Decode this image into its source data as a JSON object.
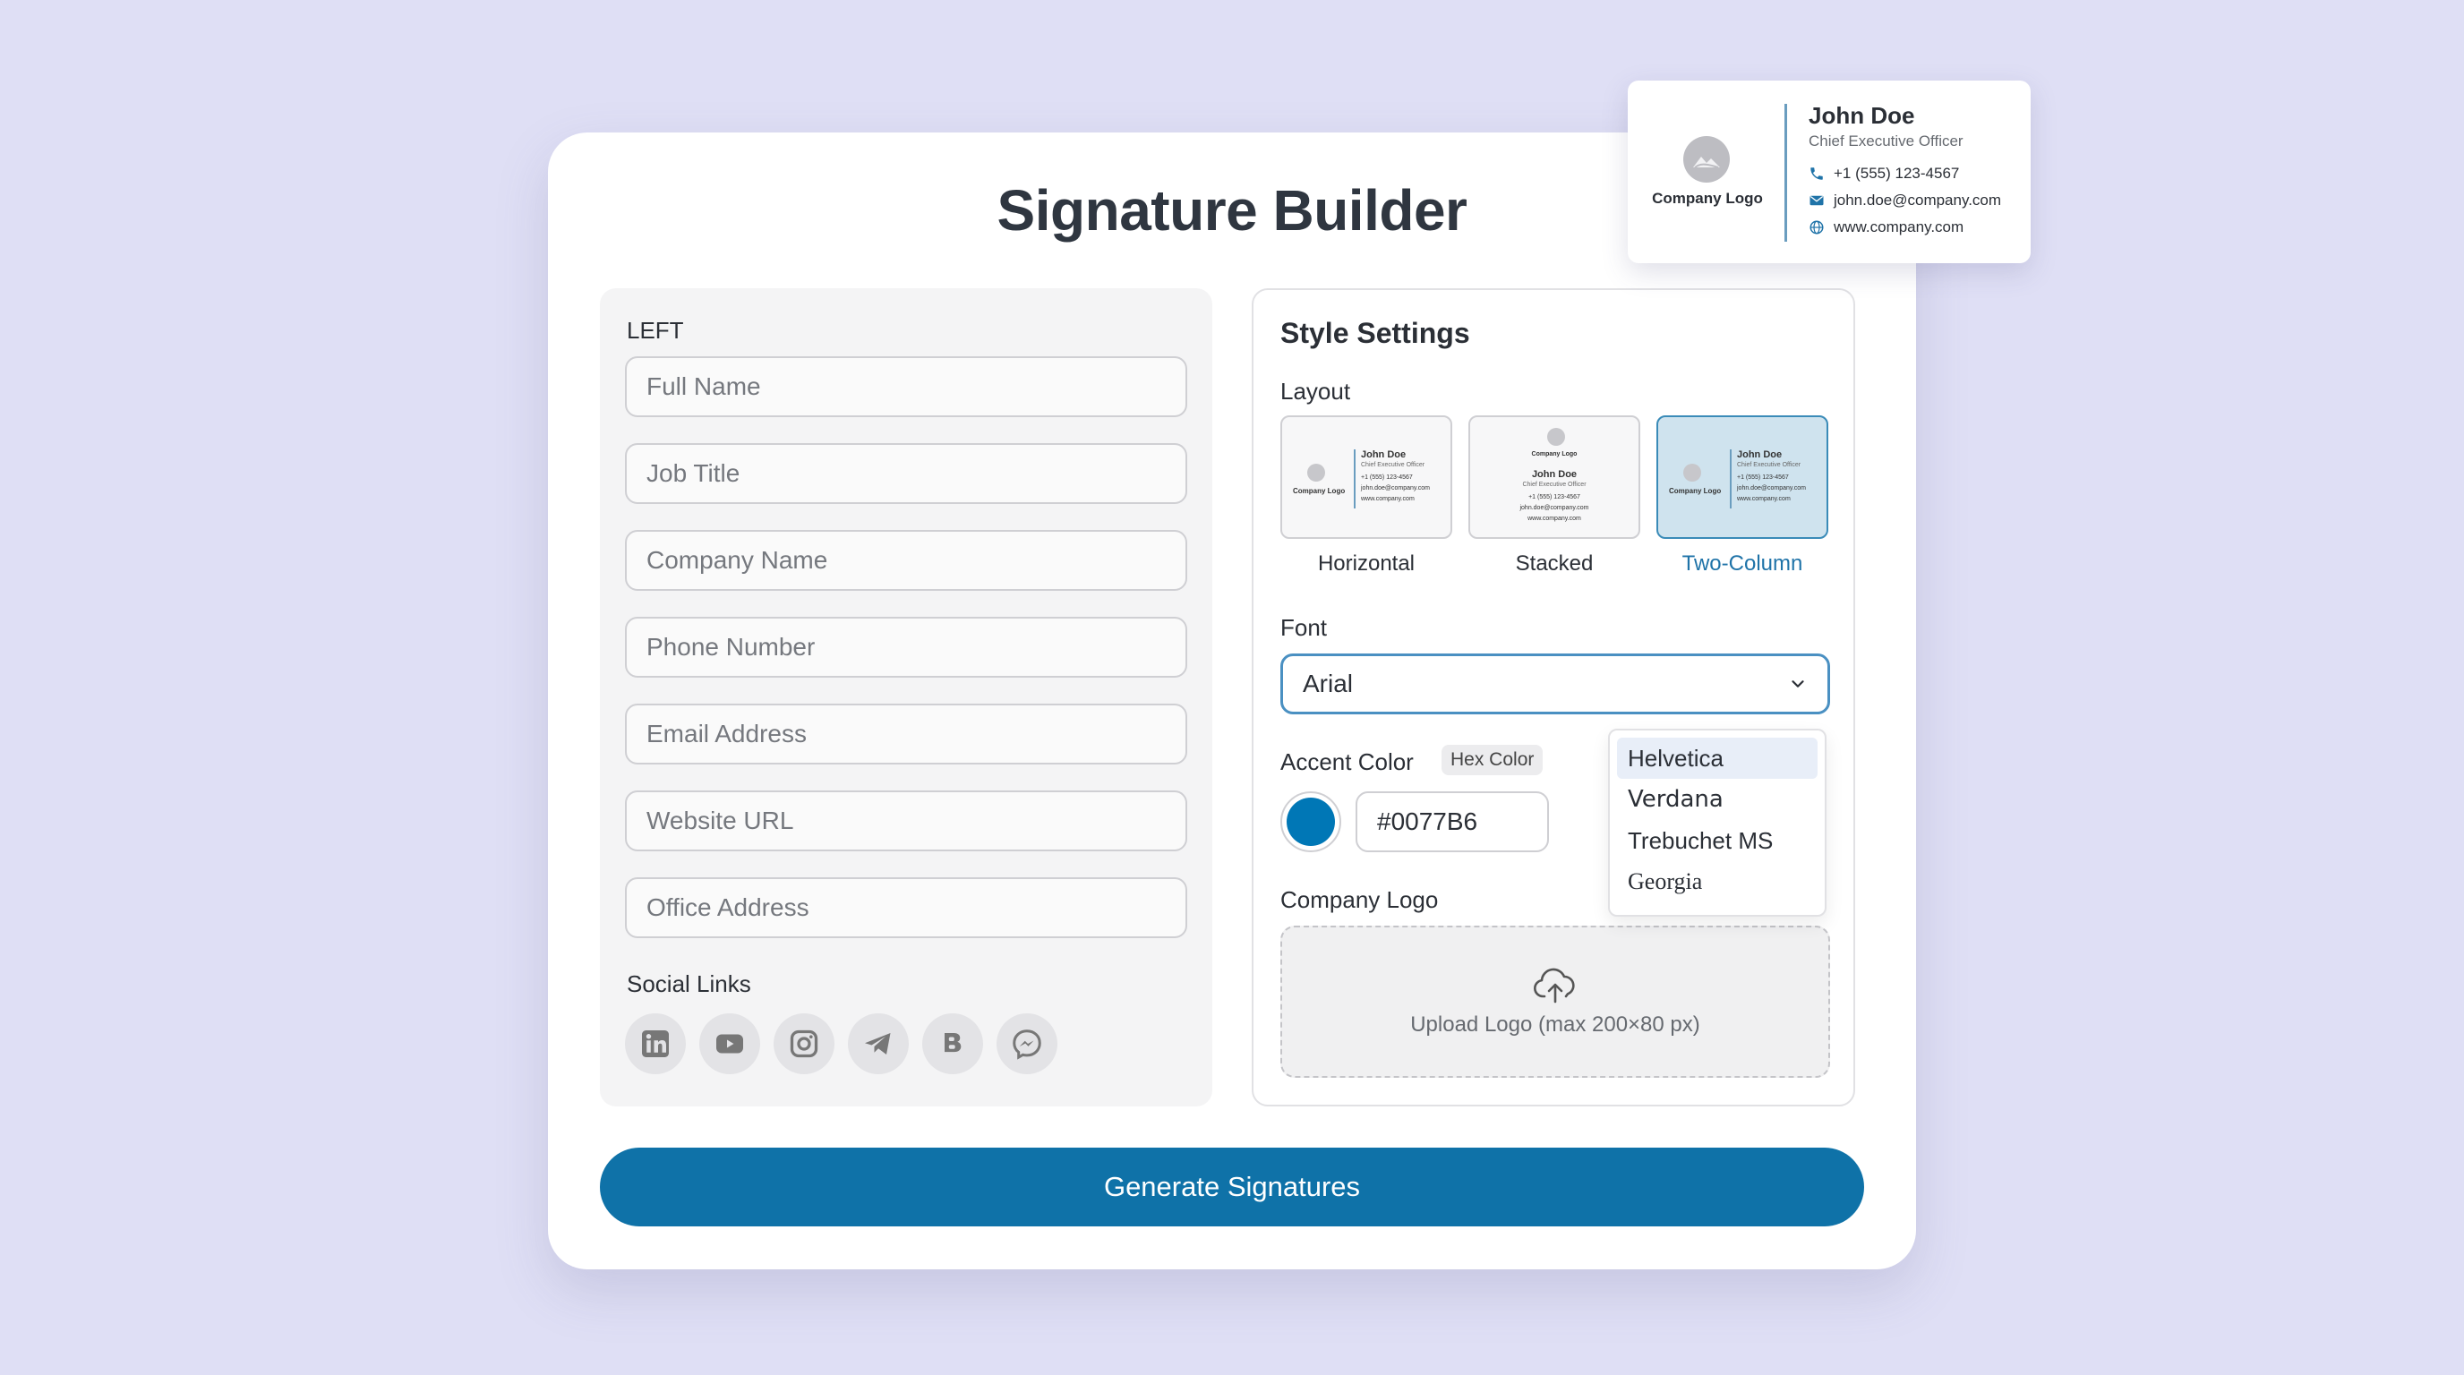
{
  "app": {
    "title": "Signature Builder"
  },
  "left_panel": {
    "section_label": "LEFT",
    "fields": [
      {
        "name": "full-name-field",
        "placeholder": "Full Name"
      },
      {
        "name": "job-title-field",
        "placeholder": "Job Title"
      },
      {
        "name": "company-name-field",
        "placeholder": "Company Name"
      },
      {
        "name": "phone-number-field",
        "placeholder": "Phone Number"
      },
      {
        "name": "email-address-field",
        "placeholder": "Email Address"
      },
      {
        "name": "website-url-field",
        "placeholder": "Website URL"
      },
      {
        "name": "office-address-field",
        "placeholder": "Office Address"
      }
    ],
    "social_label": "Social Links",
    "social_icons": [
      "linkedin-icon",
      "youtube-icon",
      "instagram-icon",
      "telegram-icon",
      "behance-icon",
      "messenger-icon"
    ]
  },
  "style_settings": {
    "title": "Style Settings",
    "layout_label": "Layout",
    "layouts": [
      {
        "label": "Horizontal",
        "selected": false
      },
      {
        "label": "Stacked",
        "selected": false
      },
      {
        "label": "Two-Column",
        "selected": true
      }
    ],
    "thumb": {
      "name": "John Doe",
      "title": "Chief Executive Officer",
      "phone": "+1 (555) 123-4567",
      "email": "john.doe@company.com",
      "web": "www.company.com",
      "logo": "Company Logo"
    },
    "font_label": "Font",
    "font_value": "Arial",
    "font_options": [
      "Helvetica",
      "Verdana",
      "Trebuchet MS",
      "Georgia"
    ],
    "font_highlighted": "Helvetica",
    "accent_label": "Accent Color",
    "hex_badge": "Hex Color",
    "accent_hex": "#0077B6",
    "logo_label": "Company Logo",
    "upload_text": "Upload Logo (max 200×80 px)"
  },
  "generate_button": "Generate Signatures",
  "preview": {
    "logo_text": "Company Logo",
    "name": "John Doe",
    "title": "Chief Executive Officer",
    "phone": "+1 (555) 123-4567",
    "email": "john.doe@company.com",
    "website": "www.company.com"
  },
  "colors": {
    "accent": "#0077B6",
    "background": "#dfdff5",
    "button": "#0f72a8"
  }
}
